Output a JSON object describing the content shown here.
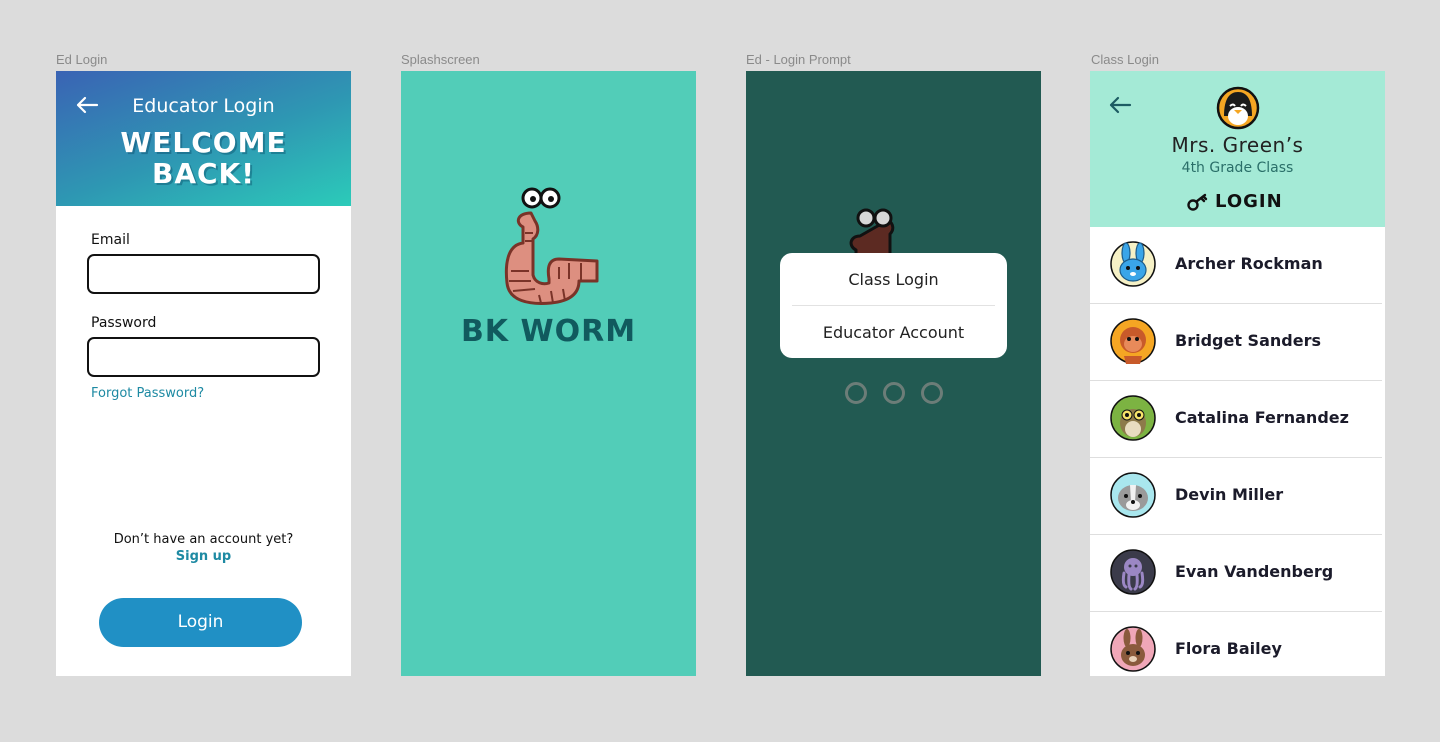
{
  "frames": {
    "ed_login": {
      "label": "Ed Login",
      "subtitle": "Educator Login",
      "title_line1": "WELCOME",
      "title_line2": "BACK!",
      "email_label": "Email",
      "email_value": "",
      "password_label": "Password",
      "password_value": "",
      "forgot_password": "Forgot Password?",
      "no_account": "Don’t have an account yet?",
      "sign_up": "Sign up",
      "login_button": "Login"
    },
    "splashscreen": {
      "label": "Splashscreen",
      "logo_text": "BK WORM"
    },
    "login_prompt": {
      "label": "Ed - Login Prompt",
      "options": [
        "Class Login",
        "Educator Account"
      ],
      "dots": 3
    },
    "class_login": {
      "label": "Class Login",
      "teacher": "Mrs. Green’s",
      "grade": "4th Grade Class",
      "login_label": "LOGIN",
      "students": [
        {
          "name": "Archer Rockman",
          "avatar": "bunny-icon"
        },
        {
          "name": "Bridget Sanders",
          "avatar": "monkey-icon"
        },
        {
          "name": "Catalina Fernandez",
          "avatar": "owl-icon"
        },
        {
          "name": "Devin Miller",
          "avatar": "badger-icon"
        },
        {
          "name": "Evan Vandenberg",
          "avatar": "octopus-icon"
        },
        {
          "name": "Flora Bailey",
          "avatar": "rabbit-icon"
        }
      ]
    }
  },
  "colors": {
    "background": "#dcdcdc",
    "ed_header_start": "#3a63b4",
    "ed_header_end": "#2ccbb9",
    "accent_link": "#1e8aa3",
    "login_button": "#2090c5",
    "splash_bg": "#52cdb8",
    "splash_text": "#115a5e",
    "prompt_bg": "#225a52",
    "class_header": "#a4ead6"
  }
}
